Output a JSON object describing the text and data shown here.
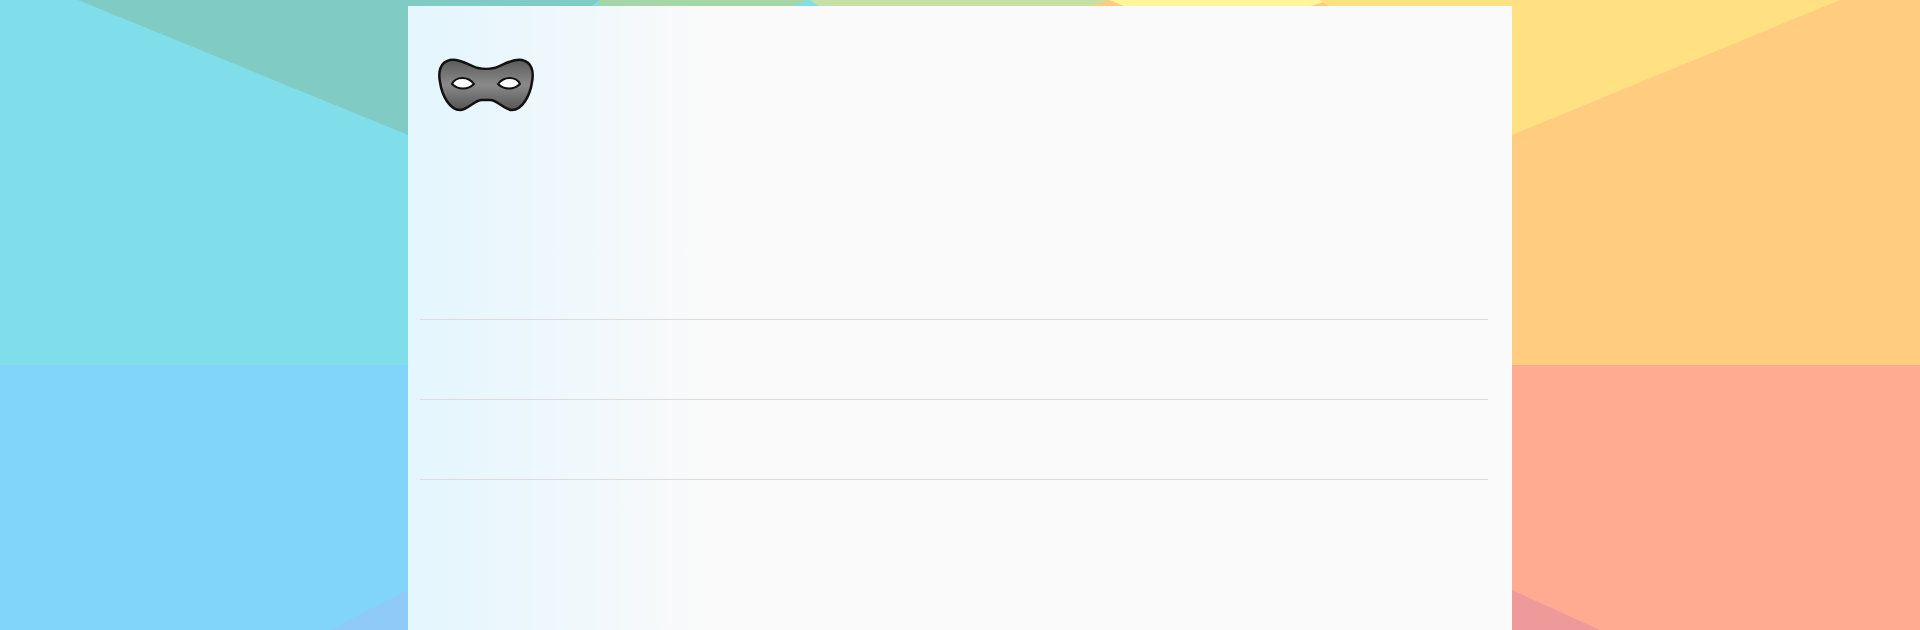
{
  "card": {
    "icon": {
      "kind": "mask"
    },
    "dividers": [
      {
        "kind": "rule"
      },
      {
        "kind": "rule"
      },
      {
        "kind": "rule"
      }
    ]
  }
}
